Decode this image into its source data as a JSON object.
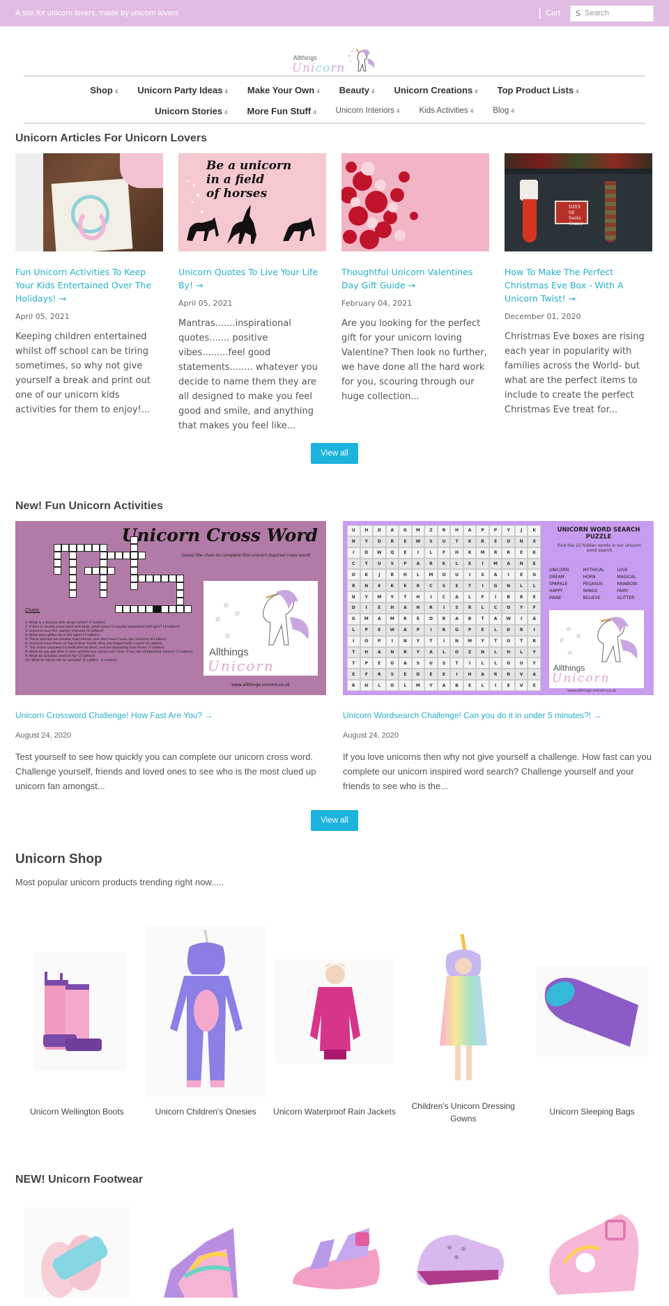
{
  "topbar": {
    "tagline": "A site for unicorn lovers, made by unicorn lovers",
    "cart_label": "Cart",
    "search_placeholder": "Search",
    "bg_color": "#e2bde3"
  },
  "logo": {
    "top": "Allthings",
    "brand_a": "Uni",
    "brand_b": "co",
    "brand_c": "rn"
  },
  "nav": {
    "row1": [
      "Shop",
      "Unicorn Party Ideas",
      "Make Your Own",
      "Beauty",
      "Unicorn Creations",
      "Top Product Lists"
    ],
    "row2": [
      "Unicorn Stories",
      "More Fun Stuff"
    ],
    "row2_light": [
      "Unicorn Interiors",
      "Kids Activities",
      "Blog"
    ],
    "caret": "4"
  },
  "articles": {
    "title": "Unicorn Articles For Unicorn Lovers",
    "items": [
      {
        "title": "Fun Unicorn Activities To Keep Your Kids Entertained Over The Holidays! →",
        "date": "April 05, 2021",
        "excerpt": "Keeping children entertained whilst off school can be tiring sometimes, so why not give yourself a break and print out one of our unicorn kids activities for them to enjoy!..."
      },
      {
        "title": "Unicorn Quotes To Live Your Life By! →",
        "date": "April 05, 2021",
        "excerpt": "Mantras.......inspirational quotes....... positive vibes.........feel good statements........ whatever you decide to name them they are all designed to make you feel good and smile, and anything that makes you feel like...",
        "image_text": [
          "Be a unicorn",
          "in a field",
          "of horses"
        ]
      },
      {
        "title": "Thoughtful Unicorn Valentines Day Gift Guide →",
        "date": "February 04, 2021",
        "excerpt": "Are you looking for the perfect gift for your unicorn loving Valentine? Then look no further, we have done all the hard work for you, scouring through our huge collection..."
      },
      {
        "title": "How To Make The Perfect Christmas Eve Box - With A Unicorn Twist! →",
        "date": "December 01, 2020",
        "excerpt": "Christmas Eve boxes are rising each year in popularity with families across the World- but what are the perfect items to include to create the perfect Christmas Eve treat for...",
        "image_text": [
          "DAYS till",
          "Santa",
          "Comes"
        ]
      }
    ],
    "view_all": "View all"
  },
  "activities": {
    "title": "New! Fun Unicorn Activities",
    "items": [
      {
        "title": "Unicorn Crossword Challenge! How Fast Are You? →",
        "date": "August 24, 2020",
        "excerpt": "Test yourself to see how quickly you can complete our unicorn cross word. Challenge yourself, friends and loved ones to see who is the most clued up unicorn fan amongst...",
        "image": {
          "heading": "Unicorn Cross Word",
          "subheading": "Guess the clues to complete this unicorn inspired cross word!",
          "clues_label": "Clues:",
          "clues": [
            "1: What is a Unicorn with wings called? (7 Letters)",
            "2: If blue is usually associated with boys, what colour is usually associated with girls? (4 Letters)",
            "3: Unicorns love this sparkly shimmer (5 Letters)",
            "4: What does glitter do in the light? (7 Letters)",
            "5: These animals are smaller than horses, and don't have horns like Unicorns (6 Letters)",
            "6: Unicorns have these on top of their heads, they are shaped with a point (4 Letters)",
            "7: This entire crossword is dedicated to them, and we absolutely love them! (7 Letters)",
            "8: What do you get after it rains and the sun comes out? Clue- it has lots of beautiful colours! (7 Letters)",
            "9: What do Unicorns need to fly? (5 Letters)",
            "10: What do fairies like to sprinkle? (5 Letters - 4 Letters)"
          ],
          "brand_top": "Allthings",
          "brand_bottom": "Unicorn",
          "url": "www.allthings-unicorn.co.uk"
        }
      },
      {
        "title": "Unicorn Wordsearch Challenge! Can you do it in under 5 minutes?! →",
        "date": "August 24, 2020",
        "excerpt": "If you love unicorns then why not give yourself a challenge. How fast can you complete our unicorn inspired word search? Challenge yourself and your friends to see who is the...",
        "image": {
          "heading": "UNICORN WORD SEARCH PUZZLE",
          "subheading": "Find the 15 hidden words in our Unicorn word search",
          "grid": [
            "UHDAGMZRHAPPYJK",
            "NYDREWSUTKREONX",
            "IDWQEILFHKMRREK",
            "CYUSPARKLEIMANE",
            "OKJRHLMOUISAIEG",
            "RNEKERCSETIGNLL",
            "NYMYTHICALFIBRE",
            "DIEHAHRISRLCOYF",
            "GMAMREORABTAWIA",
            "LPEWAPIRGPELDRI",
            "IOPINYTINMYTOTR",
            "THANRYALOZNLHLY",
            "TPEGASUSTILLOUY",
            "EFRSEDEEIHARRVA",
            "RHLOLMYABELIEVE"
          ],
          "words": [
            "UNICORN",
            "MYTHICAL",
            "LOVE",
            "DREAM",
            "HORN",
            "MAGICAL",
            "SPARKLE",
            "PEGASUS",
            "RAINBOW",
            "HAPPY",
            "WINGS",
            "FAIRY",
            "MANE",
            "BELIEVE",
            "GLITTER"
          ],
          "brand_top": "Allthings",
          "brand_bottom": "Unicorn",
          "url": "www.allthings-unicorn.co.uk"
        }
      }
    ],
    "view_all": "View all"
  },
  "shop": {
    "title": "Unicorn Shop",
    "subtitle": "Most popular unicorn products trending right now.....",
    "products": [
      {
        "name": "Unicorn Wellington Boots"
      },
      {
        "name": "Unicorn Children's Onesies"
      },
      {
        "name": "Unicorn Waterproof Rain Jackets"
      },
      {
        "name": "Children's Unicorn Dressing Gowns"
      },
      {
        "name": "Unicorn Sleeping Bags"
      }
    ]
  },
  "footwear": {
    "title": "NEW! Unicorn Footwear",
    "items": [
      "unicorn-sliders",
      "unicorn-high-top-trainers",
      "unicorn-sandals",
      "unicorn-clogs",
      "unicorn-jelly-sandals"
    ]
  },
  "colors": {
    "link": "#26b0c9",
    "button": "#1cb3dd",
    "topbar": "#e2bde3"
  }
}
